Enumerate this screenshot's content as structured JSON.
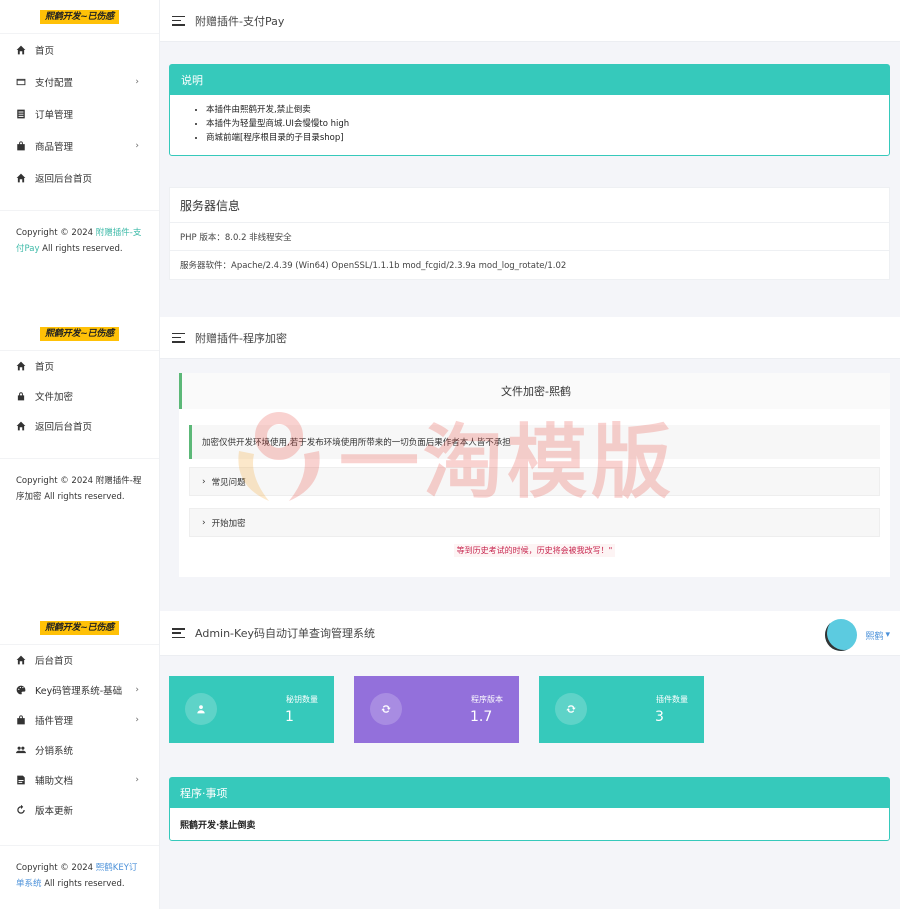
{
  "panel1": {
    "brand": "熙鹤开发~已伤感",
    "nav": [
      {
        "label": "首页",
        "icon": "home",
        "caret": false
      },
      {
        "label": "支付配置",
        "icon": "credit-card",
        "caret": true
      },
      {
        "label": "订单管理",
        "icon": "list",
        "caret": false
      },
      {
        "label": "商品管理",
        "icon": "shopping-bag",
        "caret": true
      },
      {
        "label": "返回后台首页",
        "icon": "home",
        "caret": false
      }
    ],
    "copyright_prefix": "Copyright © 2024 ",
    "copyright_link": "附赠插件-支付Pay",
    "copyright_suffix": " All rights reserved.",
    "title": "附赠插件-支付Pay",
    "notice": {
      "title": "说明",
      "items": [
        "本插件由熙鹤开发,禁止倒卖",
        "本插件为轻量型商城.UI会慢慢to high",
        "商城前端[程序根目录的子目录shop]"
      ]
    },
    "server": {
      "title": "服务器信息",
      "rows": [
        "PHP 版本：8.0.2 非线程安全",
        "服务器软件：Apache/2.4.39 (Win64) OpenSSL/1.1.1b mod_fcgid/2.3.9a mod_log_rotate/1.02"
      ]
    }
  },
  "panel2": {
    "brand": "熙鹤开发~已伤感",
    "nav": [
      {
        "label": "首页",
        "icon": "home"
      },
      {
        "label": "文件加密",
        "icon": "lock"
      },
      {
        "label": "返回后台首页",
        "icon": "home"
      }
    ],
    "copyright": "Copyright © 2024 附赠插件-程序加密 All rights reserved.",
    "title": "附赠插件-程序加密",
    "card_title": "文件加密-熙鹤",
    "note": "加密仅供开发环境使用,若于发布环境使用所带来的一切负面后果作者本人皆不承担",
    "collapses": [
      "常见问题",
      "开始加密"
    ],
    "quote": "等到历史考试的时候，历史将会被我改写！\"",
    "watermark": "一淘模版"
  },
  "panel3": {
    "brand": "熙鹤开发~已伤感",
    "nav": [
      {
        "label": "后台首页",
        "icon": "home",
        "caret": false
      },
      {
        "label": "Key码管理系统-基础",
        "icon": "palette",
        "caret": true
      },
      {
        "label": "插件管理",
        "icon": "shopping-bag",
        "caret": true
      },
      {
        "label": "分销系统",
        "icon": "users",
        "caret": false
      },
      {
        "label": "辅助文档",
        "icon": "document",
        "caret": true
      },
      {
        "label": "版本更新",
        "icon": "refresh",
        "caret": false
      }
    ],
    "copyright_prefix": "Copyright © 2024 ",
    "copyright_link": "熙鹤KEY订单系统",
    "copyright_suffix": " All rights reserved.",
    "title": "Admin-Key码自动订单查询管理系统",
    "user": "熙鹤",
    "stats": [
      {
        "label": "秘钥数量",
        "value": "1",
        "icon": "user",
        "color": "#36c9bb"
      },
      {
        "label": "程序版本",
        "value": "1.7",
        "icon": "sync",
        "color": "#9370db"
      },
      {
        "label": "插件数量",
        "value": "3",
        "icon": "sync",
        "color": "#36c9bb"
      }
    ],
    "notice_title": "程序·事项",
    "notice_body": "熙鹤开发·禁止倒卖"
  },
  "colors": {
    "teal": "#36c9bb",
    "purple": "#9370db",
    "brand_yellow": "#ffc107",
    "green_accent": "#5cb878",
    "quote_red": "#c7254e",
    "link_blue": "#4a90d9"
  }
}
